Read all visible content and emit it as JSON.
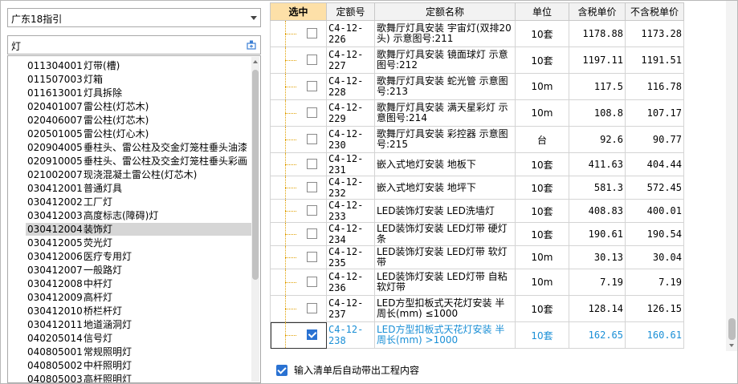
{
  "region": {
    "selected": "广东18指引"
  },
  "search": {
    "value": "灯"
  },
  "tree": [
    {
      "code": "011304001",
      "name": "灯带(槽)"
    },
    {
      "code": "011507003",
      "name": "灯箱"
    },
    {
      "code": "011613001",
      "name": "灯具拆除"
    },
    {
      "code": "020401007",
      "name": "雷公柱(灯芯木)"
    },
    {
      "code": "020406007",
      "name": "雷公柱(灯芯木)"
    },
    {
      "code": "020501005",
      "name": "雷公柱(灯心木)"
    },
    {
      "code": "020904005",
      "name": "垂柱头、雷公柱及交金灯笼柱垂头油漆"
    },
    {
      "code": "020910005",
      "name": "垂柱头、雷公柱及交金灯笼柱垂头彩画"
    },
    {
      "code": "021002007",
      "name": "现浇混凝土雷公柱(灯芯木)"
    },
    {
      "code": "030412001",
      "name": "普通灯具"
    },
    {
      "code": "030412002",
      "name": "工厂灯"
    },
    {
      "code": "030412003",
      "name": "高度标志(障碍)灯"
    },
    {
      "code": "030412004",
      "name": "装饰灯"
    },
    {
      "code": "030412005",
      "name": "荧光灯"
    },
    {
      "code": "030412006",
      "name": "医疗专用灯"
    },
    {
      "code": "030412007",
      "name": "一般路灯"
    },
    {
      "code": "030412008",
      "name": "中杆灯"
    },
    {
      "code": "030412009",
      "name": "高杆灯"
    },
    {
      "code": "030412010",
      "name": "桥栏杆灯"
    },
    {
      "code": "030412011",
      "name": "地道涵洞灯"
    },
    {
      "code": "040205014",
      "name": "信号灯"
    },
    {
      "code": "040805001",
      "name": "常规照明灯"
    },
    {
      "code": "040805002",
      "name": "中杆照明灯"
    },
    {
      "code": "040805003",
      "name": "高杆照明灯"
    }
  ],
  "grid": {
    "headers": [
      "选中",
      "定额号",
      "定额名称",
      "单位",
      "含税单价",
      "不含税单价"
    ],
    "rows": [
      {
        "code": "C4-12-226",
        "name": "歌舞厅灯具安装 宇宙灯(双排20头) 示意图号:211",
        "unit": "10套",
        "tax": "1178.88",
        "notax": "1173.28",
        "checked": false
      },
      {
        "code": "C4-12-227",
        "name": "歌舞厅灯具安装 镜面球灯 示意图号:212",
        "unit": "10套",
        "tax": "1197.11",
        "notax": "1191.51",
        "checked": false
      },
      {
        "code": "C4-12-228",
        "name": "歌舞厅灯具安装 蛇光管 示意图号:213",
        "unit": "10m",
        "tax": "117.5",
        "notax": "116.78",
        "checked": false
      },
      {
        "code": "C4-12-229",
        "name": "歌舞厅灯具安装 满天星彩灯 示意图号:214",
        "unit": "10m",
        "tax": "108.8",
        "notax": "107.17",
        "checked": false
      },
      {
        "code": "C4-12-230",
        "name": "歌舞厅灯具安装 彩控器 示意图号:215",
        "unit": "台",
        "tax": "92.6",
        "notax": "90.77",
        "checked": false
      },
      {
        "code": "C4-12-231",
        "name": "嵌入式地灯安装 地板下",
        "unit": "10套",
        "tax": "411.63",
        "notax": "404.44",
        "checked": false
      },
      {
        "code": "C4-12-232",
        "name": "嵌入式地灯安装 地坪下",
        "unit": "10套",
        "tax": "581.3",
        "notax": "572.45",
        "checked": false
      },
      {
        "code": "C4-12-233",
        "name": "LED装饰灯安装 LED洗墙灯",
        "unit": "10套",
        "tax": "408.83",
        "notax": "400.01",
        "checked": false
      },
      {
        "code": "C4-12-234",
        "name": "LED装饰灯安装 LED灯带 硬灯条",
        "unit": "10套",
        "tax": "190.61",
        "notax": "190.54",
        "checked": false
      },
      {
        "code": "C4-12-235",
        "name": "LED装饰灯安装 LED灯带 软灯带",
        "unit": "10m",
        "tax": "30.13",
        "notax": "30.04",
        "checked": false
      },
      {
        "code": "C4-12-236",
        "name": "LED装饰灯安装 LED灯带 自粘软灯带",
        "unit": "10m",
        "tax": "7.19",
        "notax": "7.19",
        "checked": false
      },
      {
        "code": "C4-12-237",
        "name": "LED方型扣板式天花灯安装 半周长(mm) ≤1000",
        "unit": "10套",
        "tax": "128.14",
        "notax": "126.15",
        "checked": false
      },
      {
        "code": "C4-12-238",
        "name": "LED方型扣板式天花灯安装 半周长(mm) >1000",
        "unit": "10套",
        "tax": "162.65",
        "notax": "160.61",
        "checked": true
      }
    ]
  },
  "option": {
    "label": "输入清单后自动带出工程内容"
  }
}
